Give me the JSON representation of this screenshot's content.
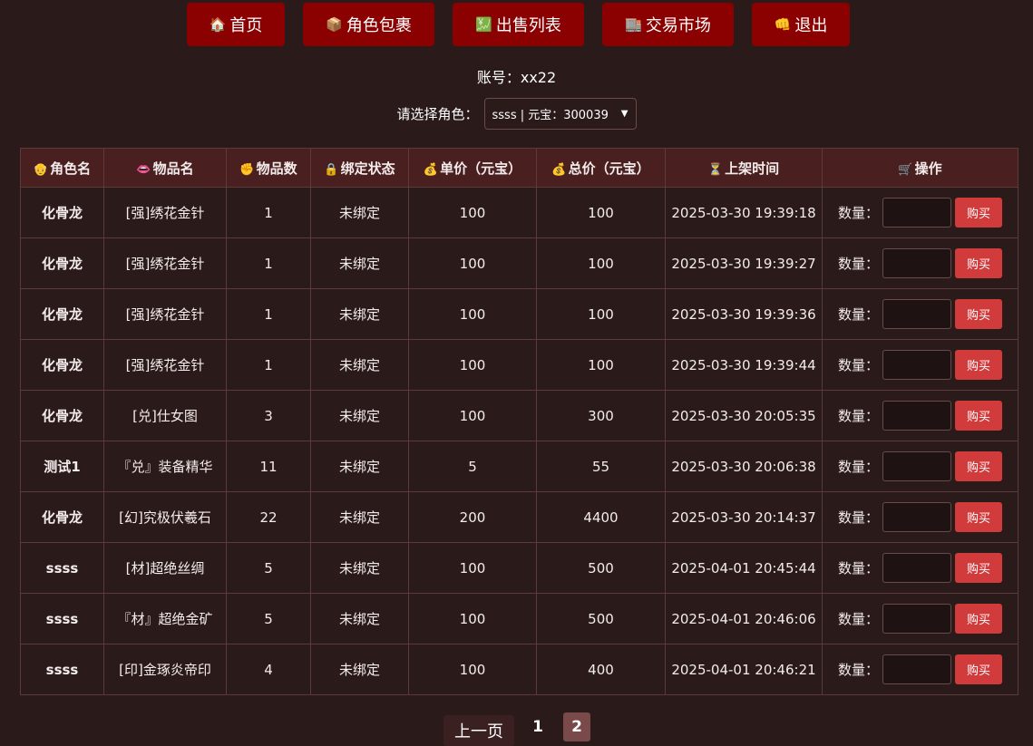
{
  "nav": [
    {
      "icon": "🏠",
      "label": "首页"
    },
    {
      "icon": "📦",
      "label": "角色包裹"
    },
    {
      "icon": "💹",
      "label": "出售列表"
    },
    {
      "icon": "🏬",
      "label": "交易市场"
    },
    {
      "icon": "👊",
      "label": "退出"
    }
  ],
  "account": {
    "text": "账号：xx22"
  },
  "role": {
    "label": "请选择角色：",
    "selected": "ssss | 元宝：300039"
  },
  "table": {
    "headers": [
      {
        "icon": "👴",
        "label": "角色名"
      },
      {
        "icon": "👄",
        "label": "物品名"
      },
      {
        "icon": "✊",
        "label": "物品数"
      },
      {
        "icon": "🔒",
        "label": "绑定状态"
      },
      {
        "icon": "💰",
        "label": "单价（元宝）"
      },
      {
        "icon": "💰",
        "label": "总价（元宝）"
      },
      {
        "icon": "⏳",
        "label": "上架时间"
      },
      {
        "icon": "🛒",
        "label": "操作"
      }
    ],
    "qty_label": "数量：",
    "buy_label": "购买",
    "rows": [
      {
        "role": "化骨龙",
        "item": "[强]绣花金针",
        "count": "1",
        "bind": "未绑定",
        "unit": "100",
        "total": "100",
        "time": "2025-03-30 19:39:18"
      },
      {
        "role": "化骨龙",
        "item": "[强]绣花金针",
        "count": "1",
        "bind": "未绑定",
        "unit": "100",
        "total": "100",
        "time": "2025-03-30 19:39:27"
      },
      {
        "role": "化骨龙",
        "item": "[强]绣花金针",
        "count": "1",
        "bind": "未绑定",
        "unit": "100",
        "total": "100",
        "time": "2025-03-30 19:39:36"
      },
      {
        "role": "化骨龙",
        "item": "[强]绣花金针",
        "count": "1",
        "bind": "未绑定",
        "unit": "100",
        "total": "100",
        "time": "2025-03-30 19:39:44"
      },
      {
        "role": "化骨龙",
        "item": "[兑]仕女图",
        "count": "3",
        "bind": "未绑定",
        "unit": "100",
        "total": "300",
        "time": "2025-03-30 20:05:35"
      },
      {
        "role": "测试1",
        "item": "『兑』装备精华",
        "count": "11",
        "bind": "未绑定",
        "unit": "5",
        "total": "55",
        "time": "2025-03-30 20:06:38"
      },
      {
        "role": "化骨龙",
        "item": "[幻]究极伏羲石",
        "count": "22",
        "bind": "未绑定",
        "unit": "200",
        "total": "4400",
        "time": "2025-03-30 20:14:37"
      },
      {
        "role": "ssss",
        "item": "[材]超绝丝绸",
        "count": "5",
        "bind": "未绑定",
        "unit": "100",
        "total": "500",
        "time": "2025-04-01 20:45:44"
      },
      {
        "role": "ssss",
        "item": "『材』超绝金矿",
        "count": "5",
        "bind": "未绑定",
        "unit": "100",
        "total": "500",
        "time": "2025-04-01 20:46:06"
      },
      {
        "role": "ssss",
        "item": "[印]金琢炎帝印",
        "count": "4",
        "bind": "未绑定",
        "unit": "100",
        "total": "400",
        "time": "2025-04-01 20:46:21"
      }
    ]
  },
  "pager": {
    "prev": "上一页",
    "page1": "1",
    "page2": "2"
  }
}
